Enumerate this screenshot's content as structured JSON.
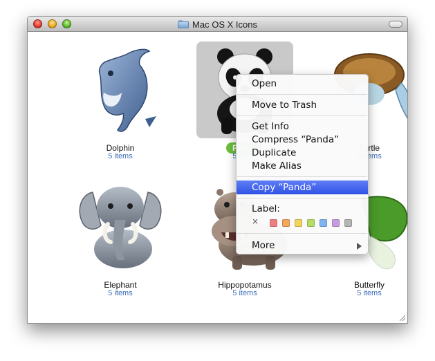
{
  "window": {
    "title": "Mac OS X Icons"
  },
  "items": [
    {
      "name": "Dolphin",
      "count": "5 items",
      "icon": "dolphin-icon"
    },
    {
      "name": "Panda",
      "count": "5 items",
      "icon": "panda-icon",
      "selected": true
    },
    {
      "name": "Turtle",
      "count": "5 items",
      "icon": "turtle-icon"
    },
    {
      "name": "Elephant",
      "count": "5 items",
      "icon": "elephant-icon"
    },
    {
      "name": "Hippopotamus",
      "count": "5 items",
      "icon": "hippopotamus-icon"
    },
    {
      "name": "Butterfly",
      "count": "5 items",
      "icon": "butterfly-icon"
    }
  ],
  "context_menu": {
    "open": "Open",
    "move_to_trash": "Move to Trash",
    "get_info": "Get Info",
    "compress": "Compress “Panda”",
    "duplicate": "Duplicate",
    "make_alias": "Make Alias",
    "copy": "Copy “Panda”",
    "label": "Label:",
    "no_label": "×",
    "more": "More",
    "label_colors": [
      "#f08080",
      "#f5a85a",
      "#f3d35b",
      "#b7dd64",
      "#7fb4ef",
      "#c89be0",
      "#b5b5b5"
    ]
  },
  "colors": {
    "selection": "#6cbf3c",
    "highlight": "#2f52e5",
    "count_text": "#3e6fb8"
  }
}
